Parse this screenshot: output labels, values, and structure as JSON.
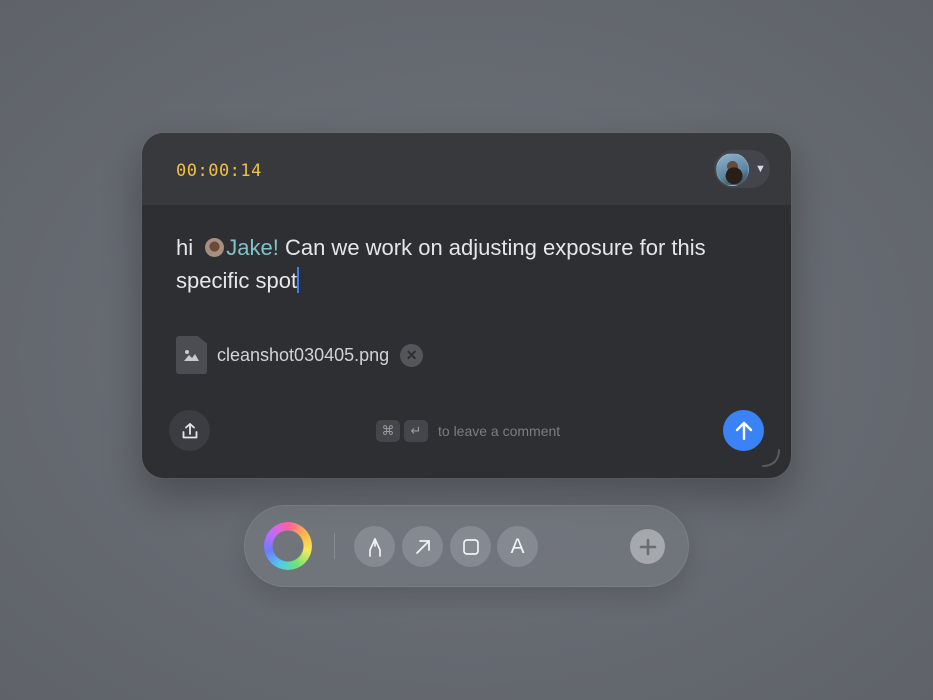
{
  "header": {
    "timer": "00:00:14",
    "user_avatar_icon": "avatar-icon",
    "dropdown_icon": "chevron-down-icon"
  },
  "message": {
    "prefix": "hi ",
    "mention": "Jake!",
    "text": " Can we work on adjusting exposure for this specific spot"
  },
  "attachment": {
    "file_name": "cleanshot030405.png",
    "icon": "image-file-icon",
    "remove_icon": "close-icon"
  },
  "footer": {
    "upload_icon": "upload-icon",
    "shortcut_keys": [
      "⌘",
      "↵"
    ],
    "hint": "to leave a comment",
    "send_icon": "arrow-up-icon"
  },
  "toolbar": {
    "tools": [
      {
        "name": "pen-tool",
        "icon": "pen-nib-icon"
      },
      {
        "name": "arrow-tool",
        "icon": "arrow-up-right-icon"
      },
      {
        "name": "rectangle-tool",
        "icon": "square-icon"
      },
      {
        "name": "text-tool",
        "label": "A"
      }
    ],
    "add_icon": "plus-icon",
    "accent_colors": [
      "#3b82f6",
      "#f0c040",
      "#7fc2cc"
    ]
  }
}
